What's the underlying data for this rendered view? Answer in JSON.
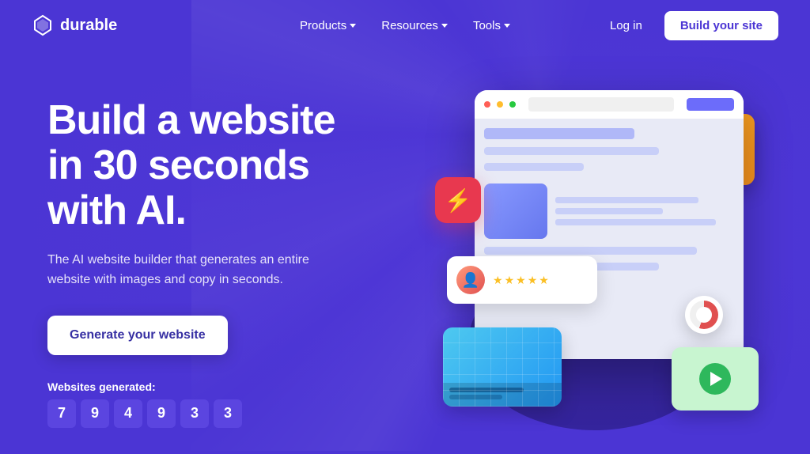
{
  "brand": {
    "name": "durable",
    "logo_icon": "diamond"
  },
  "nav": {
    "links": [
      {
        "label": "Products",
        "has_dropdown": true
      },
      {
        "label": "Resources",
        "has_dropdown": true
      },
      {
        "label": "Tools",
        "has_dropdown": true
      }
    ],
    "login_label": "Log in",
    "build_label": "Build your site"
  },
  "hero": {
    "title_line1": "Build a website",
    "title_line2": "in 30 seconds",
    "title_line3": "with AI.",
    "subtitle": "The AI website builder that generates an entire website with images and copy in seconds.",
    "cta_label": "Generate your website"
  },
  "counter": {
    "label": "Websites generated:",
    "digits": [
      "7",
      "9",
      "4",
      "9",
      "3",
      "3"
    ]
  },
  "illustration": {
    "stars": [
      "★",
      "★",
      "★",
      "★",
      "★"
    ],
    "play_icon": "▶"
  }
}
